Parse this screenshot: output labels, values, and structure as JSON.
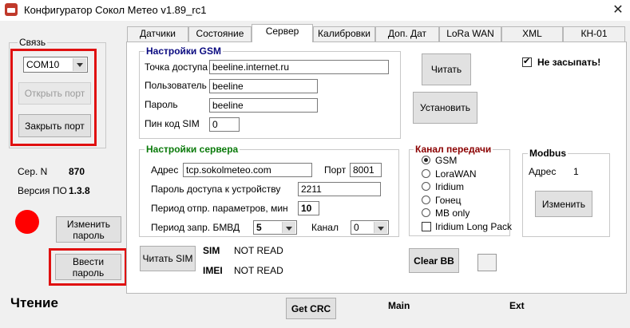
{
  "window": {
    "title": "Конфигуратор Сокол Метео v1.89_rc1",
    "close_glyph": "✕"
  },
  "left": {
    "group_title": "Связь",
    "port_value": "COM10",
    "open_port": "Открыть порт",
    "close_port": "Закрыть порт",
    "serial_label": "Сер. N",
    "serial_value": "870",
    "version_label": "Версия ПО",
    "version_value": "1.3.8",
    "status_color": "#ff0000",
    "change_password": "Изменить пароль",
    "enter_password": "Ввести пароль",
    "reading_status": "Чтение"
  },
  "tabs": [
    "Датчики",
    "Состояние",
    "Сервер",
    "Калибровки",
    "Доп. Дат",
    "LoRa WAN",
    "XML",
    "КН-01"
  ],
  "gsm": {
    "title": "Настройки GSM",
    "apn_label": "Точка доступа",
    "apn_value": "beeline.internet.ru",
    "user_label": "Пользователь",
    "user_value": "beeline",
    "password_label": "Пароль",
    "password_value": "beeline",
    "pin_label": "Пин код SIM",
    "pin_value": "0"
  },
  "server": {
    "title": "Настройки сервера",
    "address_label": "Адрес",
    "address_value": "tcp.sokolmeteo.com",
    "port_label": "Порт",
    "port_value": "8001",
    "device_password_label": "Пароль доступа к устройству",
    "device_password_value": "2211",
    "send_period_label": "Период отпр. параметров, мин",
    "send_period_value": "10",
    "poll_period_label": "Период запр.  БМВД",
    "poll_period_value": "5",
    "channel_label": "Канал",
    "channel_value": "0"
  },
  "buttons": {
    "read": "Читать",
    "set": "Установить",
    "read_sim": "Читать SIM",
    "clear_bb": "Clear BB",
    "change": "Изменить",
    "get_crc": "Get CRC"
  },
  "no_sleep": {
    "label": "Не засыпать!",
    "checked": true
  },
  "channel": {
    "title": "Канал передачи",
    "options": [
      "GSM",
      "LoraWAN",
      "Iridium",
      "Гонец",
      "MB only"
    ],
    "selected": "GSM",
    "long_pack_label": "Iridium Long Pack"
  },
  "modbus": {
    "title": "Modbus",
    "address_label": "Адрес",
    "address_value": "1"
  },
  "sim": {
    "sim_label": "SIM",
    "sim_value": "NOT READ",
    "imei_label": "IMEI",
    "imei_value": "NOT READ"
  },
  "footer": {
    "main": "Main",
    "ext": "Ext"
  }
}
